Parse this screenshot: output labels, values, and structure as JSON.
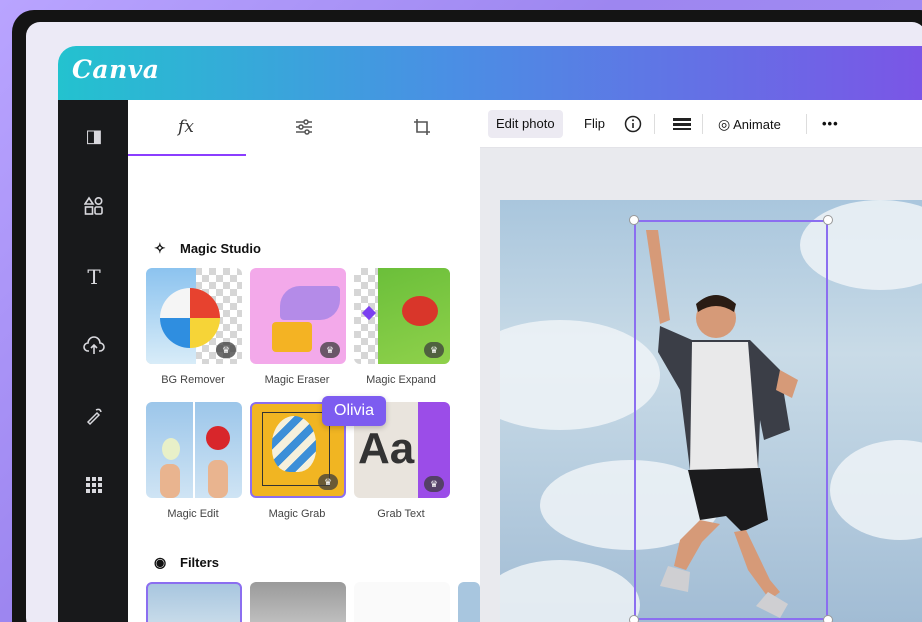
{
  "app": {
    "logo": "Canva"
  },
  "panel": {
    "tabs": [
      {
        "icon": "fx-icon",
        "label": "fx"
      },
      {
        "icon": "adjust-sliders-icon",
        "label": ""
      },
      {
        "icon": "crop-icon",
        "label": ""
      }
    ],
    "magic_studio": {
      "title": "Magic Studio",
      "tools": [
        {
          "label": "BG Remover"
        },
        {
          "label": "Magic Eraser"
        },
        {
          "label": "Magic Expand"
        },
        {
          "label": "Magic Edit"
        },
        {
          "label": "Magic Grab"
        },
        {
          "label": "Grab Text"
        }
      ],
      "grab_text_sample": "Aa"
    },
    "filters": {
      "title": "Filters"
    }
  },
  "cursor_label": "Olivia",
  "toolbar": {
    "edit_photo": "Edit photo",
    "flip": "Flip",
    "animate": "Animate",
    "more": "•••"
  },
  "colors": {
    "accent": "#8b3dff",
    "collab": "#7d5cf0",
    "rail": "#18191b"
  }
}
